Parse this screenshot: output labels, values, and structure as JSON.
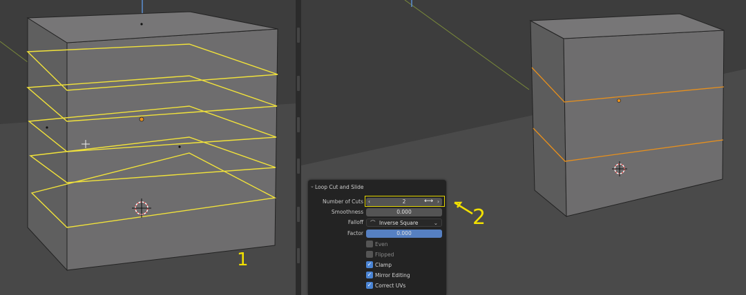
{
  "annotations": {
    "left_step": "1",
    "right_step": "2"
  },
  "colors": {
    "loop_cut_preview": "#f2e33a",
    "selected_edge": "#e8901c",
    "highlight_box": "#e6d800",
    "field_active": "#5680c2"
  },
  "panel": {
    "title": "Loop Cut and Slide",
    "number_of_cuts": {
      "label": "Number of Cuts",
      "value": "2"
    },
    "smoothness": {
      "label": "Smoothness",
      "value": "0.000"
    },
    "falloff": {
      "label": "Falloff",
      "value": "Inverse Square"
    },
    "factor": {
      "label": "Factor",
      "value": "0.000"
    },
    "options": [
      {
        "label": "Even",
        "checked": false
      },
      {
        "label": "Flipped",
        "checked": false
      },
      {
        "label": "Clamp",
        "checked": true
      },
      {
        "label": "Mirror Editing",
        "checked": true
      },
      {
        "label": "Correct UVs",
        "checked": true
      }
    ]
  }
}
